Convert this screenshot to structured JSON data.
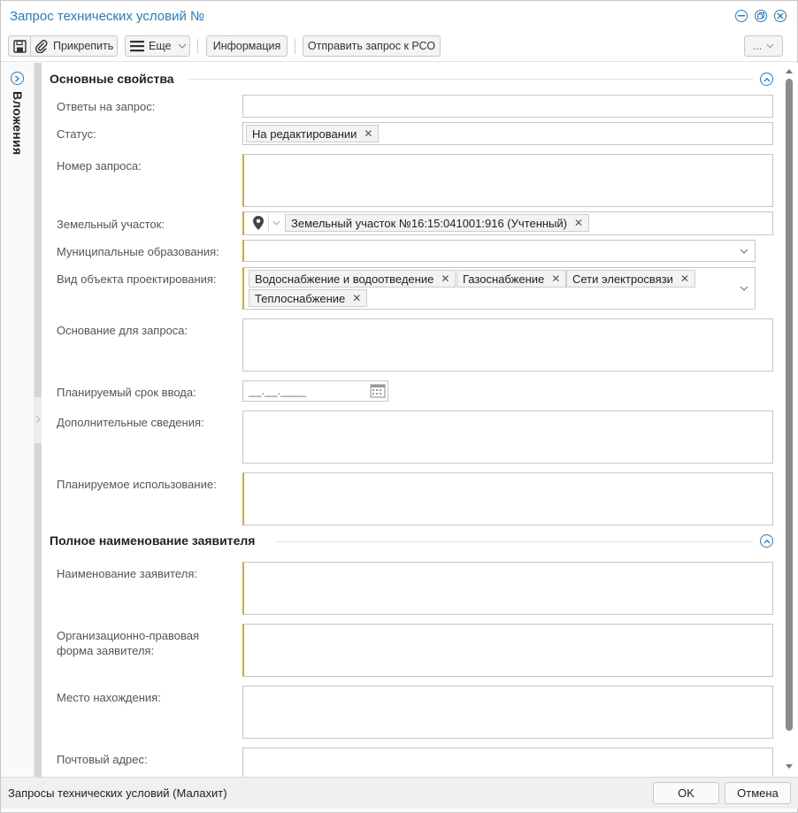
{
  "window": {
    "title": "Запрос технических условий №"
  },
  "toolbar": {
    "attach_label": "Прикрепить",
    "more_label": "Еще",
    "info_label": "Информация",
    "send_label": "Отправить запрос к РСО",
    "overflow_label": "..."
  },
  "side_panel": {
    "label": "Вложения"
  },
  "section1": {
    "title": "Основные свойства",
    "fields": {
      "answers": {
        "label": "Ответы на запрос:"
      },
      "status": {
        "label": "Статус:",
        "value": "На редактировании"
      },
      "request_number": {
        "label": "Номер запроса:"
      },
      "land_plot": {
        "label": "Земельный участок:",
        "value": "Земельный участок №16:15:041001:916 (Учтенный)"
      },
      "municipal": {
        "label": "Муниципальные образования:"
      },
      "object_type": {
        "label": "Вид объекта проектирования:",
        "tags": [
          "Водоснабжение и водоотведение",
          "Газоснабжение",
          "Сети электросвязи",
          "Теплоснабжение"
        ]
      },
      "basis": {
        "label": "Основание для запроса:"
      },
      "planned_date": {
        "label": "Планируемый срок ввода:",
        "placeholder": "__.__.____"
      },
      "additional": {
        "label": "Дополнительные сведения:"
      },
      "planned_use": {
        "label": "Планируемое использование:"
      }
    }
  },
  "section2": {
    "title": "Полное наименование заявителя",
    "fields": {
      "applicant_name": {
        "label": "Наименование заявителя:"
      },
      "legal_form": {
        "label_line1": "Организационно-правовая",
        "label_line2": "форма заявителя:"
      },
      "location": {
        "label": "Место нахождения:"
      },
      "postal_address": {
        "label": "Почтовый адрес:"
      }
    }
  },
  "footer": {
    "text": "Запросы технических условий (Малахит)",
    "ok_label": "OK",
    "cancel_label": "Отмена"
  },
  "colors": {
    "accent": "#2b7ac0",
    "required": "#d2ad2c"
  }
}
